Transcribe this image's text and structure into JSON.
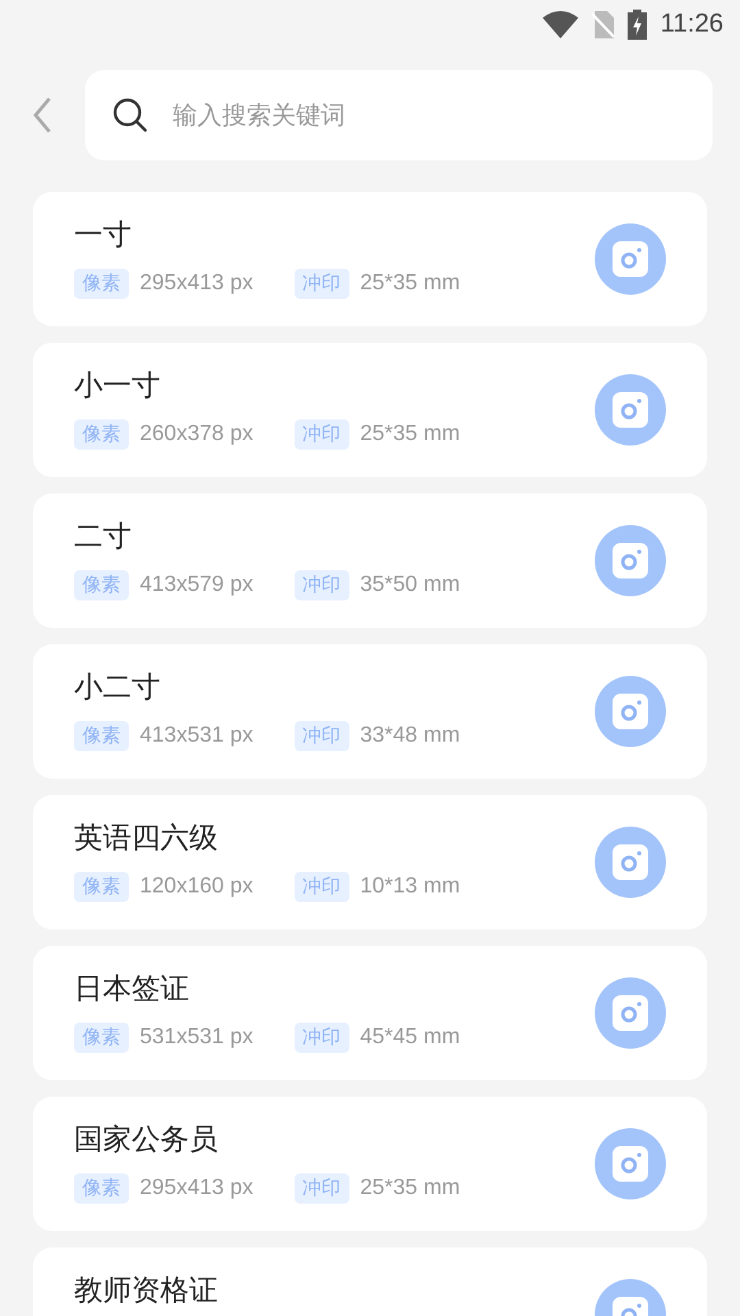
{
  "status_bar": {
    "time": "11:26"
  },
  "search": {
    "placeholder": "输入搜索关键词"
  },
  "items": [
    {
      "title": "一寸",
      "pixel_label": "像素",
      "pixels": "295x413 px",
      "print_label": "冲印",
      "print": "25*35 mm"
    },
    {
      "title": "小一寸",
      "pixel_label": "像素",
      "pixels": "260x378 px",
      "print_label": "冲印",
      "print": "25*35 mm"
    },
    {
      "title": "二寸",
      "pixel_label": "像素",
      "pixels": "413x579 px",
      "print_label": "冲印",
      "print": "35*50 mm"
    },
    {
      "title": "小二寸",
      "pixel_label": "像素",
      "pixels": "413x531 px",
      "print_label": "冲印",
      "print": "33*48 mm"
    },
    {
      "title": "英语四六级",
      "pixel_label": "像素",
      "pixels": "120x160 px",
      "print_label": "冲印",
      "print": "10*13 mm"
    },
    {
      "title": "日本签证",
      "pixel_label": "像素",
      "pixels": "531x531 px",
      "print_label": "冲印",
      "print": "45*45 mm"
    },
    {
      "title": "国家公务员",
      "pixel_label": "像素",
      "pixels": "295x413 px",
      "print_label": "冲印",
      "print": "25*35 mm"
    },
    {
      "title": "教师资格证"
    }
  ]
}
